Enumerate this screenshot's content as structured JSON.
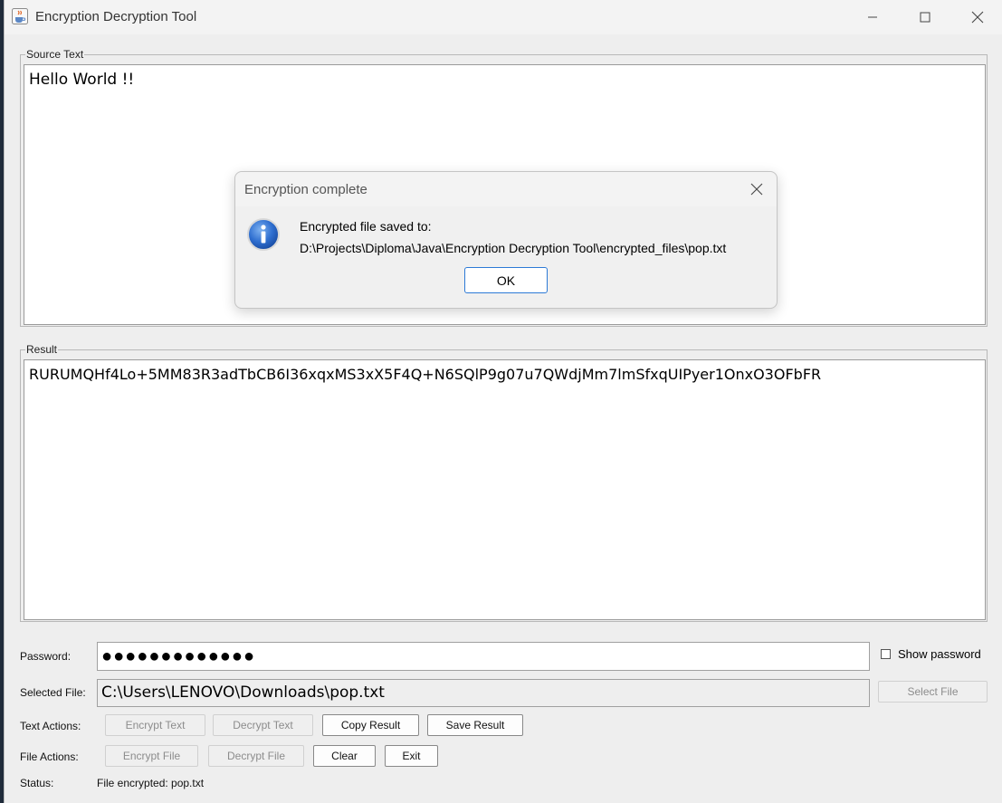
{
  "window": {
    "title": "Encryption Decryption Tool"
  },
  "source": {
    "label": "Source Text",
    "value": "Hello World !!"
  },
  "result": {
    "label": "Result",
    "value": "RURUMQHf4Lo+5MM83R3adTbCB6I36xqxMS3xX5F4Q+N6SQlP9g07u7QWdjMm7lmSfxqUIPyer1OnxO3OFbFR"
  },
  "password": {
    "label": "Password:",
    "masked_value": "●●●●●●●●●●●●●",
    "show_password_label": "Show password",
    "show_password_checked": false
  },
  "file": {
    "label": "Selected File:",
    "value": "C:\\Users\\LENOVO\\Downloads\\pop.txt",
    "select_button": "Select File"
  },
  "text_actions": {
    "label": "Text Actions:",
    "encrypt": "Encrypt Text",
    "decrypt": "Decrypt Text",
    "copy": "Copy Result",
    "save": "Save Result"
  },
  "file_actions": {
    "label": "File Actions:",
    "encrypt": "Encrypt File",
    "decrypt": "Decrypt File",
    "clear": "Clear",
    "exit": "Exit"
  },
  "status": {
    "label": "Status:",
    "value": "File encrypted: pop.txt"
  },
  "dialog": {
    "title": "Encryption complete",
    "line1": "Encrypted file saved to:",
    "line2": "D:\\Projects\\Diploma\\Java\\Encryption Decryption Tool\\encrypted_files\\pop.txt",
    "ok": "OK"
  },
  "colors": {
    "accent": "#2d7ad6",
    "window_bg": "#eeeeee"
  },
  "icons": {
    "app": "java-cup-icon",
    "dialog": "info-icon"
  }
}
